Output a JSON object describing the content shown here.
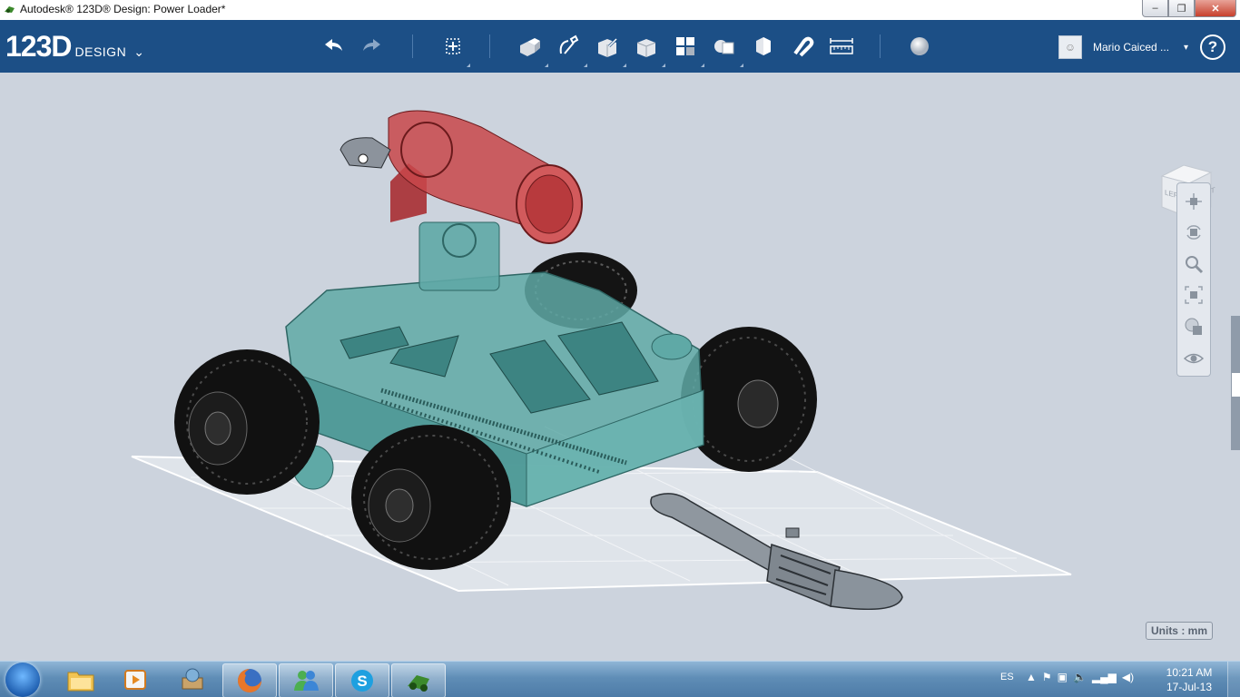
{
  "window": {
    "title": "Autodesk® 123D® Design: Power Loader*",
    "controls": {
      "minimize": "–",
      "maximize": "❐",
      "close": "✕"
    }
  },
  "toolbar": {
    "brand_big": "123D",
    "brand_small": "DESIGN",
    "brand_chevron": "⌄",
    "tools": [
      "undo-icon",
      "redo-icon",
      "transform-icon",
      "primitives-icon",
      "sketch-icon",
      "construct-icon",
      "modify-icon",
      "pattern-icon",
      "grouping-icon",
      "combine-icon",
      "measure-icon",
      "snap-icon",
      "ruler-icon",
      "material-icon"
    ],
    "user_name": "Mario Caiced ...",
    "user_dropdown": "▾",
    "help_label": "?"
  },
  "viewport": {
    "viewcube_left": "LEFT",
    "viewcube_front": "FRONT",
    "units_label": "Units : mm",
    "nav_tools": [
      "pan-icon",
      "orbit-icon",
      "zoom-icon",
      "fit-icon",
      "visual-style-icon",
      "eye-icon"
    ]
  },
  "taskbar": {
    "apps": [
      "explorer-icon",
      "media-player-icon",
      "package-icon",
      "firefox-icon",
      "messenger-icon",
      "skype-icon",
      "123d-design-icon"
    ],
    "lang": "ES",
    "time": "10:21 AM",
    "date": "17-Jul-13"
  },
  "colors": {
    "toolbar_bg": "#1c4f86",
    "viewport_bg": "#ccd3dd",
    "body_teal": "#5fa9a6",
    "turret_red": "#c8474a"
  }
}
